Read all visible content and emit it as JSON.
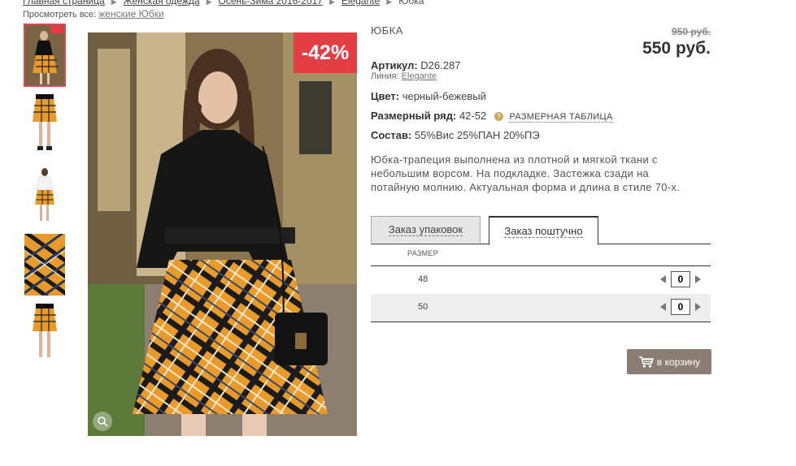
{
  "breadcrumb": [
    "Главная страница",
    "Женская одежда",
    "Осень-Зима 2016-2017",
    "Elegante",
    "Юбка"
  ],
  "view_all": {
    "label": "Просмотреть все:",
    "link": "женские Юбки"
  },
  "product": {
    "title": "ЮБКА",
    "discount": "-42%",
    "old_price": "950 руб.",
    "new_price": "550 руб.",
    "article_label": "Артикул:",
    "article": "D26.287",
    "line_label": "Линия:",
    "line": "Elegante",
    "color_label": "Цвет:",
    "color": "черный-бежевый",
    "size_range_label": "Размерный ряд:",
    "size_range": "42-52",
    "size_table_link": "РАЗМЕРНАЯ ТАБЛИЦА",
    "composition_label": "Состав:",
    "composition": "55%Вис 25%ПАН 20%ПЭ",
    "description": "Юбка-трапеция выполнена из плотной и мягкой ткани с небольшим ворсом. На подкладке. Застежка сзади на потайную молнию. Актуальная форма и длина в стиле 70-х."
  },
  "tabs": [
    "Заказ упаковок",
    "Заказ поштучно"
  ],
  "size_table": {
    "header": "РАЗМЕР",
    "rows": [
      {
        "size": "48",
        "qty": "0"
      },
      {
        "size": "50",
        "qty": "0"
      }
    ]
  },
  "cart_button": "в корзину",
  "colors": {
    "discount": "#e23e44",
    "cart": "#8b7d74",
    "plaid": "#e89a2a"
  }
}
